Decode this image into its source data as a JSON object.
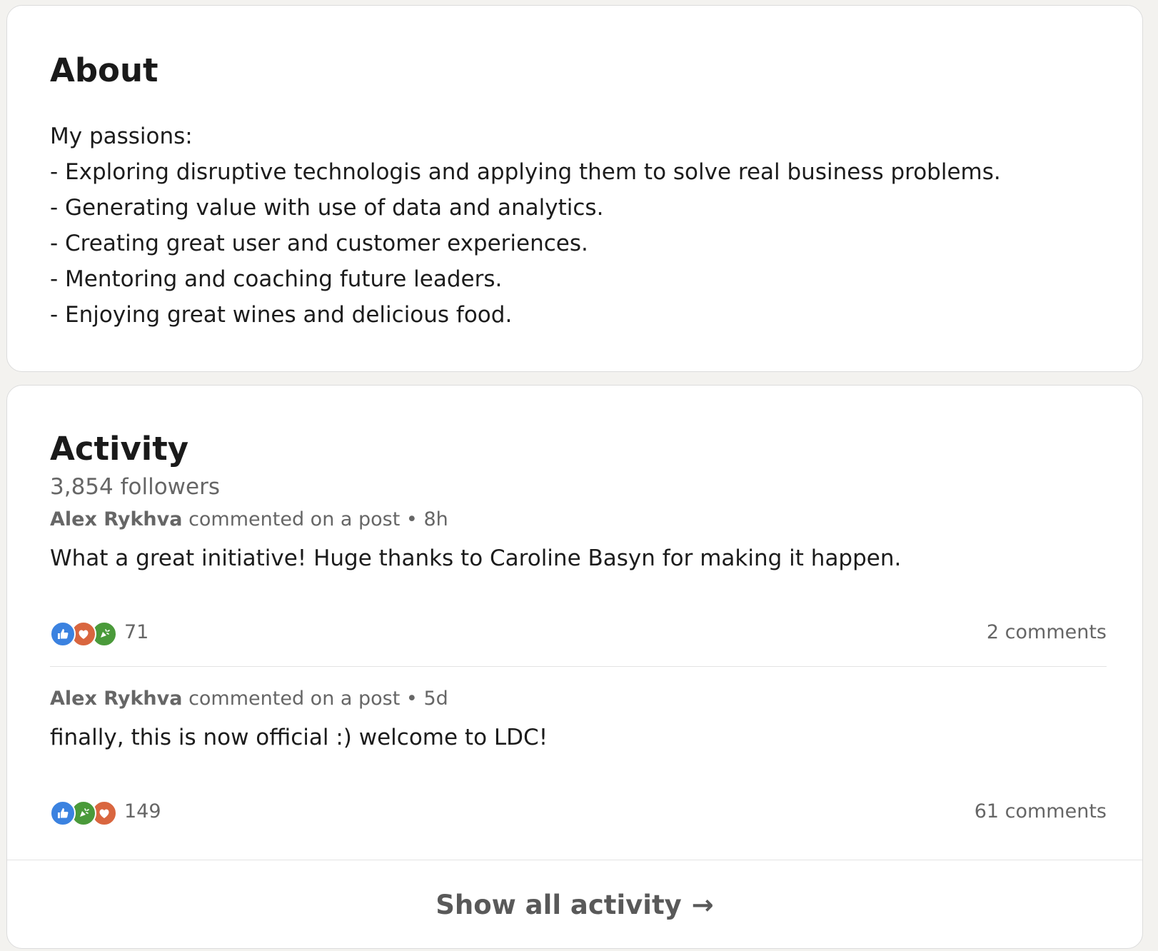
{
  "about": {
    "title": "About",
    "lines": [
      "My passions:",
      "- Exploring disruptive technologis and applying them to solve real business problems.",
      "- Generating value with use of data and analytics.",
      "- Creating great user and customer experiences.",
      "- Mentoring and coaching future leaders.",
      "- Enjoying great wines and delicious food."
    ]
  },
  "activity": {
    "title": "Activity",
    "followers": "3,854 followers",
    "items": [
      {
        "actor": "Alex Rykhva",
        "action": "commented on a post",
        "time": "8h",
        "text": "What a great initiative! Huge thanks to Caroline Basyn for making it happen.",
        "reactions": [
          "like-icon",
          "love-icon",
          "celebrate-icon"
        ],
        "reaction_count": "71",
        "comments": "2 comments"
      },
      {
        "actor": "Alex Rykhva",
        "action": "commented on a post",
        "time": "5d",
        "text": "finally, this is now official :) welcome to LDC!",
        "reactions": [
          "like-icon",
          "celebrate-icon",
          "love-icon"
        ],
        "reaction_count": "149",
        "comments": "61 comments"
      }
    ],
    "show_all_label": "Show all activity",
    "show_all_arrow": "→"
  },
  "colors": {
    "like": "#3b82e0",
    "love": "#d9663f",
    "celebrate": "#4a9a3a"
  }
}
